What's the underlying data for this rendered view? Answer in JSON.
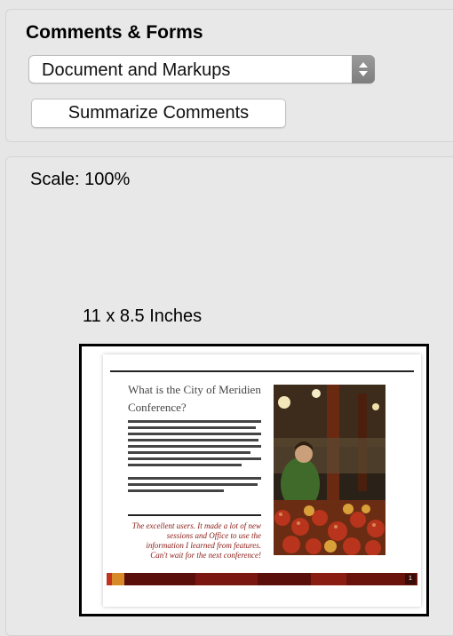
{
  "forms_section": {
    "title": "Comments & Forms",
    "select_value": "Document and Markups",
    "summarize_button": "Summarize Comments"
  },
  "preview_section": {
    "scale": "Scale: 100%",
    "paper_size": "11 x 8.5 Inches"
  },
  "thumbnail": {
    "heading": "What is the City of Meridien Conference?",
    "quote": "The excellent users. It made a lot of new sessions and Office to use the information I learned from features. Can't wait for the next conference!",
    "page_number": "1"
  },
  "colors": {
    "window_bg": "#e6e6e6",
    "stepper": "#8e8e8e",
    "quote_text": "#8a1a14",
    "band_dark": "#5a0f0b",
    "band_orange": "#d88a2a"
  }
}
